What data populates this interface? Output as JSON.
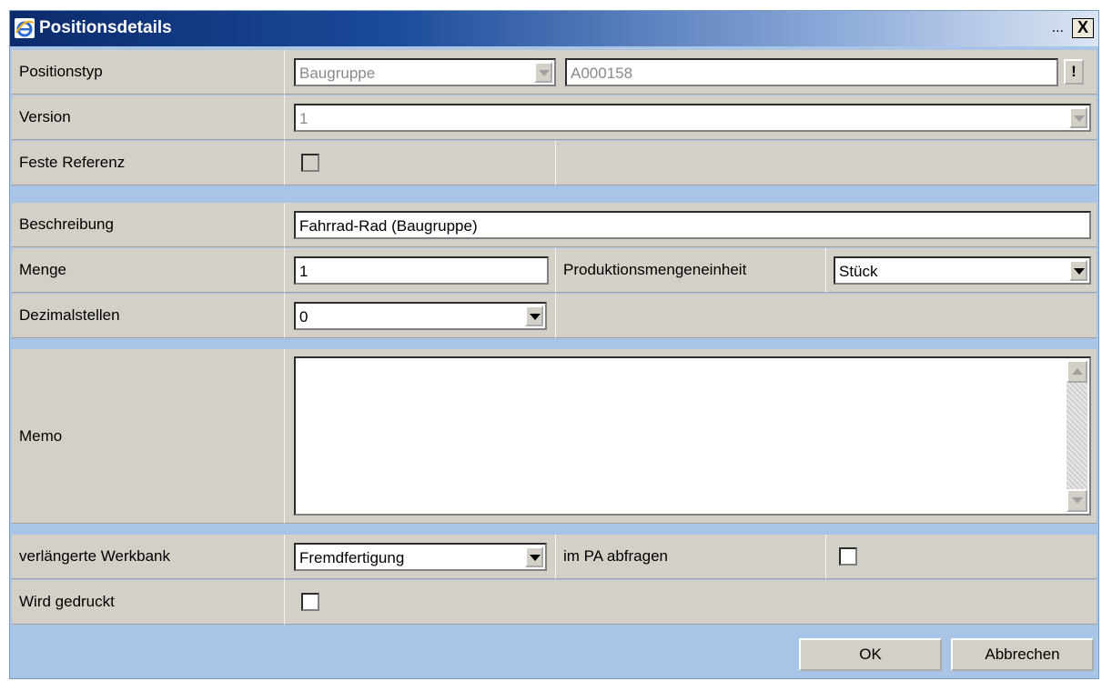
{
  "window": {
    "title": "Positionsdetails",
    "title_extra": "...",
    "close_label": "X"
  },
  "form": {
    "positionstyp": {
      "label": "Positionstyp",
      "type_value": "Baugruppe",
      "number_value": "A000158",
      "lookup_label": "!"
    },
    "version": {
      "label": "Version",
      "value": "1"
    },
    "feste_referenz": {
      "label": "Feste Referenz",
      "checked": false
    },
    "beschreibung": {
      "label": "Beschreibung",
      "value": "Fahrrad-Rad (Baugruppe)"
    },
    "menge": {
      "label": "Menge",
      "value": "1"
    },
    "produktionsmengeneinheit": {
      "label": "Produktionsmengeneinheit",
      "value": "Stück"
    },
    "dezimalstellen": {
      "label": "Dezimalstellen",
      "value": "0"
    },
    "memo": {
      "label": "Memo",
      "value": ""
    },
    "verlaengerte_werkbank": {
      "label": "verlängerte Werkbank",
      "value": "Fremdfertigung"
    },
    "im_pa_abfragen": {
      "label": "im PA abfragen",
      "checked": false
    },
    "wird_gedruckt": {
      "label": "Wird gedruckt",
      "checked": false
    }
  },
  "buttons": {
    "ok": "OK",
    "cancel": "Abbrechen"
  },
  "colors": {
    "accent": "#0b2b6c",
    "panel": "#d4d0c8",
    "separator": "#a8c4e6"
  }
}
